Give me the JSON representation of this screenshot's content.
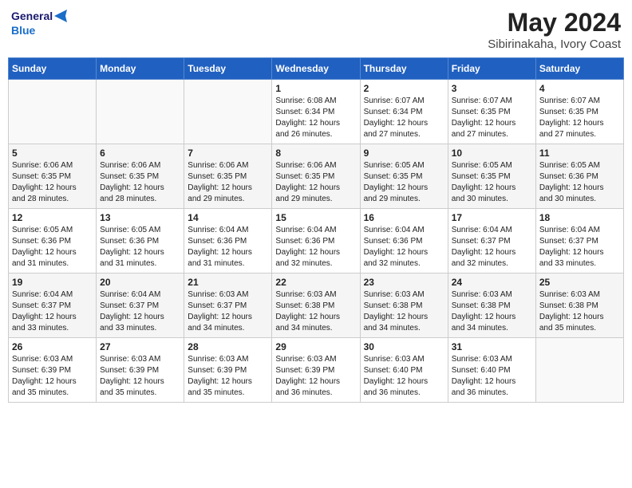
{
  "app": {
    "name": "GeneralBlue",
    "logo_symbol": "▶"
  },
  "title": "May 2024",
  "subtitle": "Sibirinakaha, Ivory Coast",
  "days_header": [
    "Sunday",
    "Monday",
    "Tuesday",
    "Wednesday",
    "Thursday",
    "Friday",
    "Saturday"
  ],
  "weeks": [
    [
      {
        "day": "",
        "info": ""
      },
      {
        "day": "",
        "info": ""
      },
      {
        "day": "",
        "info": ""
      },
      {
        "day": "1",
        "info": "Sunrise: 6:08 AM\nSunset: 6:34 PM\nDaylight: 12 hours\nand 26 minutes."
      },
      {
        "day": "2",
        "info": "Sunrise: 6:07 AM\nSunset: 6:34 PM\nDaylight: 12 hours\nand 27 minutes."
      },
      {
        "day": "3",
        "info": "Sunrise: 6:07 AM\nSunset: 6:35 PM\nDaylight: 12 hours\nand 27 minutes."
      },
      {
        "day": "4",
        "info": "Sunrise: 6:07 AM\nSunset: 6:35 PM\nDaylight: 12 hours\nand 27 minutes."
      }
    ],
    [
      {
        "day": "5",
        "info": "Sunrise: 6:06 AM\nSunset: 6:35 PM\nDaylight: 12 hours\nand 28 minutes."
      },
      {
        "day": "6",
        "info": "Sunrise: 6:06 AM\nSunset: 6:35 PM\nDaylight: 12 hours\nand 28 minutes."
      },
      {
        "day": "7",
        "info": "Sunrise: 6:06 AM\nSunset: 6:35 PM\nDaylight: 12 hours\nand 29 minutes."
      },
      {
        "day": "8",
        "info": "Sunrise: 6:06 AM\nSunset: 6:35 PM\nDaylight: 12 hours\nand 29 minutes."
      },
      {
        "day": "9",
        "info": "Sunrise: 6:05 AM\nSunset: 6:35 PM\nDaylight: 12 hours\nand 29 minutes."
      },
      {
        "day": "10",
        "info": "Sunrise: 6:05 AM\nSunset: 6:35 PM\nDaylight: 12 hours\nand 30 minutes."
      },
      {
        "day": "11",
        "info": "Sunrise: 6:05 AM\nSunset: 6:36 PM\nDaylight: 12 hours\nand 30 minutes."
      }
    ],
    [
      {
        "day": "12",
        "info": "Sunrise: 6:05 AM\nSunset: 6:36 PM\nDaylight: 12 hours\nand 31 minutes."
      },
      {
        "day": "13",
        "info": "Sunrise: 6:05 AM\nSunset: 6:36 PM\nDaylight: 12 hours\nand 31 minutes."
      },
      {
        "day": "14",
        "info": "Sunrise: 6:04 AM\nSunset: 6:36 PM\nDaylight: 12 hours\nand 31 minutes."
      },
      {
        "day": "15",
        "info": "Sunrise: 6:04 AM\nSunset: 6:36 PM\nDaylight: 12 hours\nand 32 minutes."
      },
      {
        "day": "16",
        "info": "Sunrise: 6:04 AM\nSunset: 6:36 PM\nDaylight: 12 hours\nand 32 minutes."
      },
      {
        "day": "17",
        "info": "Sunrise: 6:04 AM\nSunset: 6:37 PM\nDaylight: 12 hours\nand 32 minutes."
      },
      {
        "day": "18",
        "info": "Sunrise: 6:04 AM\nSunset: 6:37 PM\nDaylight: 12 hours\nand 33 minutes."
      }
    ],
    [
      {
        "day": "19",
        "info": "Sunrise: 6:04 AM\nSunset: 6:37 PM\nDaylight: 12 hours\nand 33 minutes."
      },
      {
        "day": "20",
        "info": "Sunrise: 6:04 AM\nSunset: 6:37 PM\nDaylight: 12 hours\nand 33 minutes."
      },
      {
        "day": "21",
        "info": "Sunrise: 6:03 AM\nSunset: 6:37 PM\nDaylight: 12 hours\nand 34 minutes."
      },
      {
        "day": "22",
        "info": "Sunrise: 6:03 AM\nSunset: 6:38 PM\nDaylight: 12 hours\nand 34 minutes."
      },
      {
        "day": "23",
        "info": "Sunrise: 6:03 AM\nSunset: 6:38 PM\nDaylight: 12 hours\nand 34 minutes."
      },
      {
        "day": "24",
        "info": "Sunrise: 6:03 AM\nSunset: 6:38 PM\nDaylight: 12 hours\nand 34 minutes."
      },
      {
        "day": "25",
        "info": "Sunrise: 6:03 AM\nSunset: 6:38 PM\nDaylight: 12 hours\nand 35 minutes."
      }
    ],
    [
      {
        "day": "26",
        "info": "Sunrise: 6:03 AM\nSunset: 6:39 PM\nDaylight: 12 hours\nand 35 minutes."
      },
      {
        "day": "27",
        "info": "Sunrise: 6:03 AM\nSunset: 6:39 PM\nDaylight: 12 hours\nand 35 minutes."
      },
      {
        "day": "28",
        "info": "Sunrise: 6:03 AM\nSunset: 6:39 PM\nDaylight: 12 hours\nand 35 minutes."
      },
      {
        "day": "29",
        "info": "Sunrise: 6:03 AM\nSunset: 6:39 PM\nDaylight: 12 hours\nand 36 minutes."
      },
      {
        "day": "30",
        "info": "Sunrise: 6:03 AM\nSunset: 6:40 PM\nDaylight: 12 hours\nand 36 minutes."
      },
      {
        "day": "31",
        "info": "Sunrise: 6:03 AM\nSunset: 6:40 PM\nDaylight: 12 hours\nand 36 minutes."
      },
      {
        "day": "",
        "info": ""
      }
    ]
  ],
  "colors": {
    "header_bg": "#2060c0",
    "header_text": "#ffffff",
    "title_color": "#222222",
    "subtitle_color": "#444444"
  }
}
